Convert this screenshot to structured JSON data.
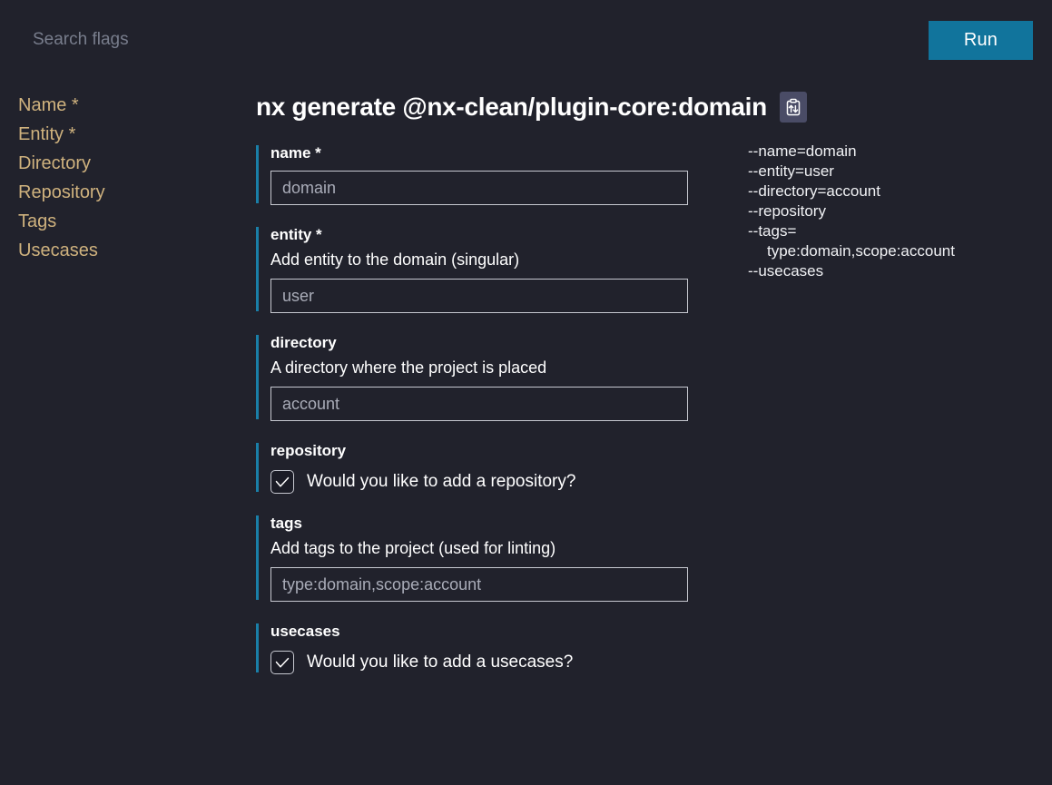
{
  "colors": {
    "background": "#21222c",
    "accent": "#1a7fa8",
    "run_button": "#11749c",
    "sidebar_text": "#cfb27e",
    "input_border": "#c6c8d0",
    "input_text": "#a9acb8",
    "copy_button_bg": "#4a4c66"
  },
  "topbar": {
    "search_placeholder": "Search flags",
    "search_value": "",
    "run_label": "Run"
  },
  "sidebar": {
    "items": [
      {
        "label": "Name",
        "required": " *"
      },
      {
        "label": "Entity",
        "required": " *"
      },
      {
        "label": "Directory",
        "required": ""
      },
      {
        "label": "Repository",
        "required": ""
      },
      {
        "label": "Tags",
        "required": ""
      },
      {
        "label": "Usecases",
        "required": ""
      }
    ]
  },
  "main": {
    "title": "nx generate @nx-clean/plugin-core:domain",
    "copy_icon": "clipboard-transfer-icon",
    "fields": [
      {
        "name": "name",
        "label": "name *",
        "description": "",
        "type": "text",
        "value": "domain",
        "placeholder": "domain"
      },
      {
        "name": "entity",
        "label": "entity *",
        "description": "Add entity to the domain (singular)",
        "type": "text",
        "value": "user",
        "placeholder": "user"
      },
      {
        "name": "directory",
        "label": "directory",
        "description": "A directory where the project is placed",
        "type": "text",
        "value": "account",
        "placeholder": "account"
      },
      {
        "name": "repository",
        "label": "repository",
        "description": "",
        "type": "checkbox",
        "checkbox_label": "Would you like to add a repository?",
        "checked": true
      },
      {
        "name": "tags",
        "label": "tags",
        "description": "Add tags to the project (used for linting)",
        "type": "text",
        "value": "type:domain,scope:account",
        "placeholder": "type:domain,scope:account"
      },
      {
        "name": "usecases",
        "label": "usecases",
        "description": "",
        "type": "checkbox",
        "checkbox_label": "Would you like to add a usecases?",
        "checked": true
      }
    ]
  },
  "command_preview": {
    "lines": [
      {
        "text": "--name=domain",
        "indent": false
      },
      {
        "text": "--entity=user",
        "indent": false
      },
      {
        "text": "--directory=account",
        "indent": false
      },
      {
        "text": "--repository",
        "indent": false
      },
      {
        "text": "--tags=",
        "indent": false
      },
      {
        "text": "type:domain,scope:account",
        "indent": true
      },
      {
        "text": "--usecases",
        "indent": false
      }
    ]
  }
}
